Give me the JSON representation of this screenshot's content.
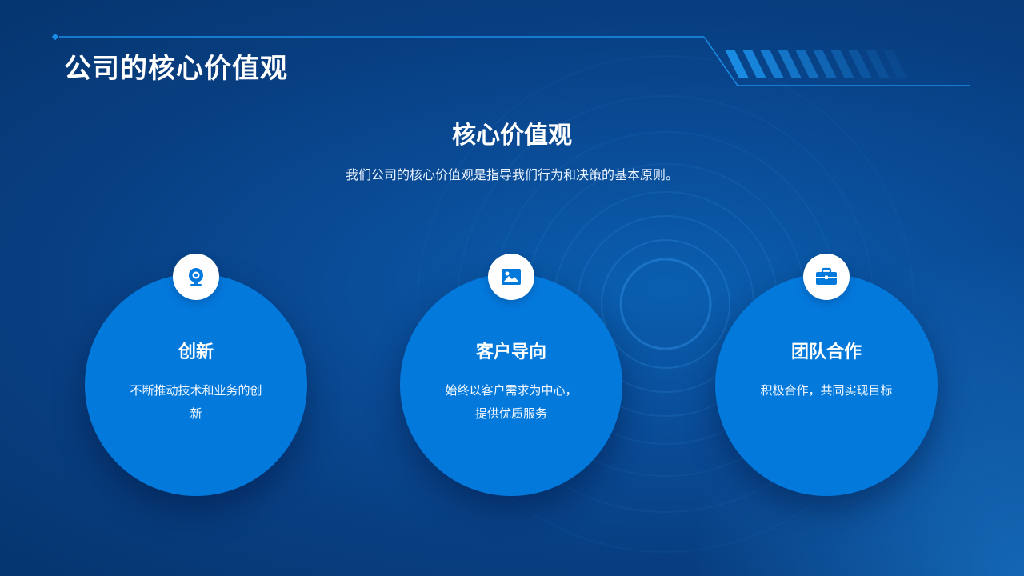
{
  "header": {
    "title": "公司的核心价值观"
  },
  "section": {
    "title": "核心价值观",
    "subtitle": "我们公司的核心价值观是指导我们行为和决策的基本原则。"
  },
  "values": [
    {
      "title": "创新",
      "desc": "不断推动技术和业务的创新",
      "icon": "webcam-icon"
    },
    {
      "title": "客户导向",
      "desc": "始终以客户需求为中心，提供优质服务",
      "icon": "image-icon"
    },
    {
      "title": "团队合作",
      "desc": "积极合作，共同实现目标",
      "icon": "briefcase-icon"
    }
  ],
  "colors": {
    "background": "#0a4c97",
    "card": "#0479dc",
    "icon": "#0479dc",
    "accent_line": "#1a8fe8"
  }
}
